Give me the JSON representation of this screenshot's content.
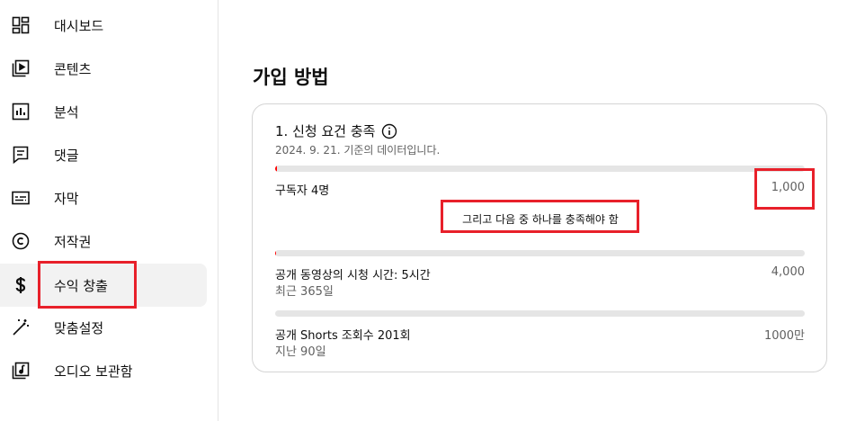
{
  "sidebar": {
    "items": [
      {
        "label": "대시보드",
        "icon": "dashboard-icon",
        "active": false
      },
      {
        "label": "콘텐츠",
        "icon": "content-icon",
        "active": false
      },
      {
        "label": "분석",
        "icon": "analytics-icon",
        "active": false
      },
      {
        "label": "댓글",
        "icon": "comments-icon",
        "active": false
      },
      {
        "label": "자막",
        "icon": "subtitles-icon",
        "active": false
      },
      {
        "label": "저작권",
        "icon": "copyright-icon",
        "active": false
      },
      {
        "label": "수익 창출",
        "icon": "dollar-icon",
        "active": true
      },
      {
        "label": "맞춤설정",
        "icon": "magic-wand-icon",
        "active": false
      },
      {
        "label": "오디오 보관함",
        "icon": "audio-library-icon",
        "active": false
      }
    ]
  },
  "main": {
    "title": "가입 방법",
    "card": {
      "heading": "1. 신청 요건 충족",
      "subtitle": "2024. 9. 21. 기준의 데이터입니다.",
      "requirement": {
        "label": "구독자 4명",
        "value": "1,000",
        "progress": 0.004
      },
      "and_text": "그리고 다음 중 하나를 충족해야 함",
      "options": [
        {
          "label": "공개 동영상의 시청 시간: 5시간",
          "sub": "최근 365일",
          "value": "4,000",
          "progress": 0.00125
        },
        {
          "label": "공개 Shorts 조회수 201회",
          "sub": "지난 90일",
          "value": "1000만",
          "progress": 2e-05
        }
      ]
    }
  },
  "colors": {
    "highlight": "#e8202a",
    "progress_track": "#e5e5e5",
    "active_nav_bg": "#f2f2f2"
  }
}
